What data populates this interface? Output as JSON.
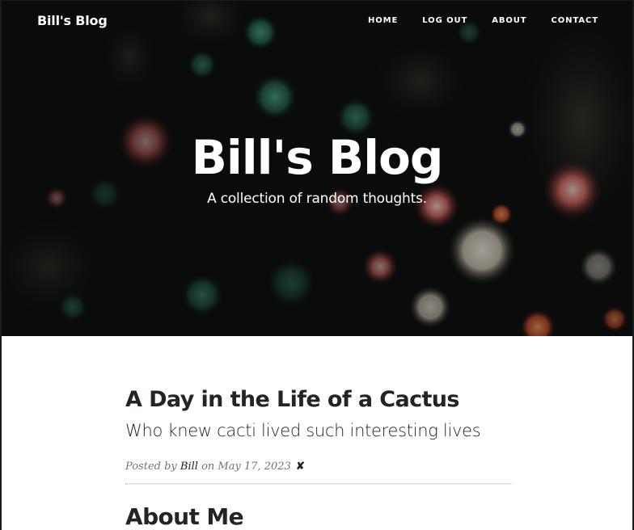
{
  "nav": {
    "brand": "Bill's Blog",
    "links": [
      "HOME",
      "LOG OUT",
      "ABOUT",
      "CONTACT"
    ]
  },
  "hero": {
    "title": "Bill's Blog",
    "subtitle": "A collection of random thoughts."
  },
  "posts": [
    {
      "title": "A Day in the Life of a Cactus",
      "subtitle": "Who knew cacti lived such interesting lives",
      "meta_prefix": "Posted by",
      "author": "Bill",
      "meta_on": "on",
      "date": "May 17, 2023",
      "delete_symbol": "✘"
    }
  ],
  "about": {
    "title": "About Me"
  },
  "colors": {
    "text": "#212529",
    "meta": "#6c757d",
    "divider": "#dee2e6",
    "hero_text": "#ffffff"
  }
}
